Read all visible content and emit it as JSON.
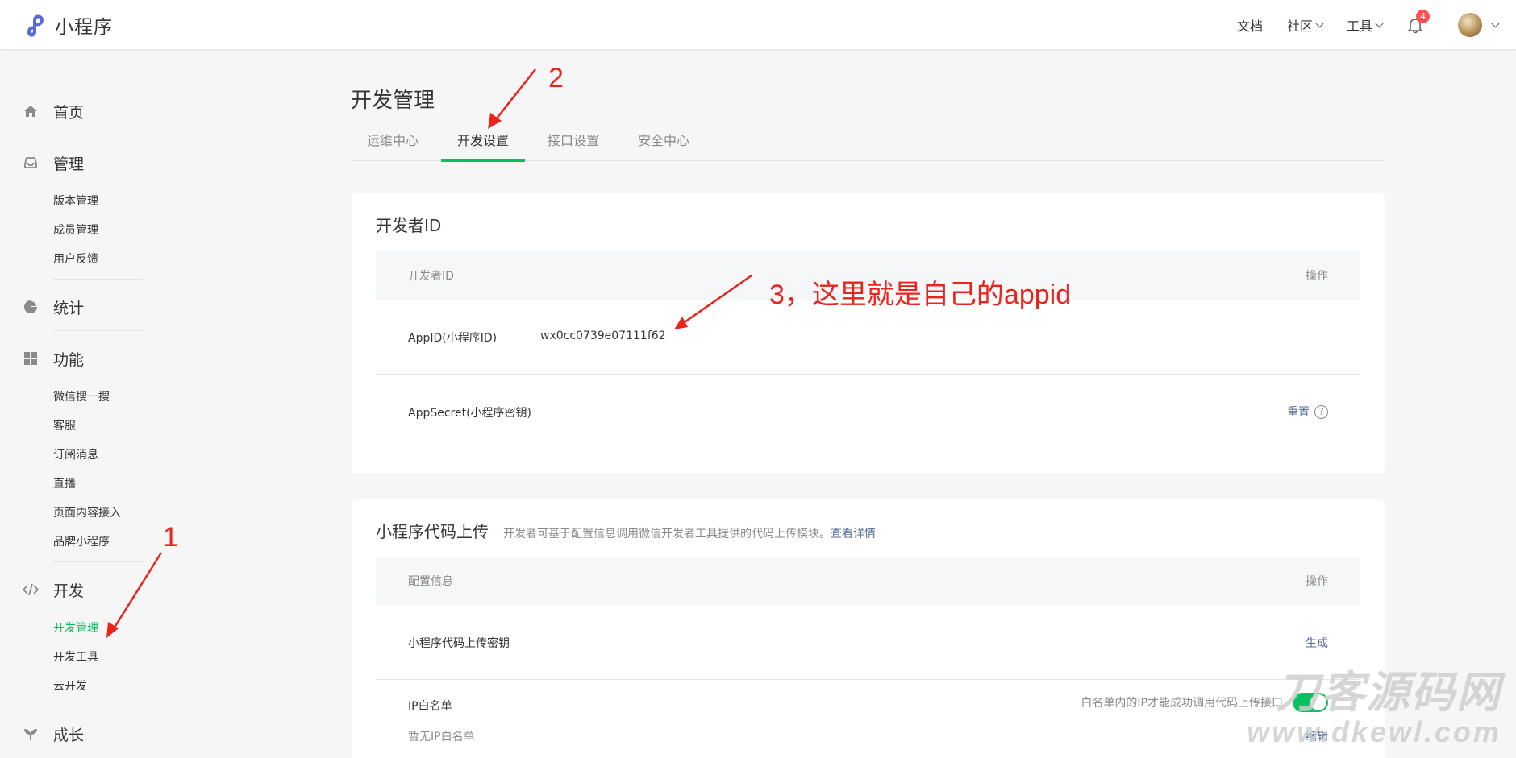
{
  "header": {
    "logo_text": "小程序",
    "nav": [
      {
        "label": "文档",
        "has_dropdown": false
      },
      {
        "label": "社区",
        "has_dropdown": true
      },
      {
        "label": "工具",
        "has_dropdown": true
      }
    ],
    "notification_count": "4"
  },
  "sidebar": {
    "groups": [
      {
        "label": "首页",
        "icon": "home-icon",
        "items": []
      },
      {
        "label": "管理",
        "icon": "inbox-icon",
        "items": [
          "版本管理",
          "成员管理",
          "用户反馈"
        ]
      },
      {
        "label": "统计",
        "icon": "pie-chart-icon",
        "items": []
      },
      {
        "label": "功能",
        "icon": "grid-icon",
        "items": [
          "微信搜一搜",
          "客服",
          "订阅消息",
          "直播",
          "页面内容接入",
          "品牌小程序"
        ]
      },
      {
        "label": "开发",
        "icon": "code-icon",
        "items": [
          "开发管理",
          "开发工具",
          "云开发"
        ]
      },
      {
        "label": "成长",
        "icon": "sprout-icon",
        "items": []
      }
    ],
    "active_item": "开发管理"
  },
  "main": {
    "title": "开发管理",
    "tabs": [
      "运维中心",
      "开发设置",
      "接口设置",
      "安全中心"
    ],
    "active_tab": "开发设置",
    "developer_card": {
      "title": "开发者ID",
      "header_left": "开发者ID",
      "header_right": "操作",
      "appid_label": "AppID(小程序ID)",
      "appid_value": "wx0cc0739e07111f62",
      "secret_label": "AppSecret(小程序密钥)",
      "secret_action": "重置",
      "help": "?"
    },
    "upload_card": {
      "title": "小程序代码上传",
      "desc": "开发者可基于配置信息调用微信开发者工具提供的代码上传模块。",
      "desc_link": "查看详情",
      "header_left": "配置信息",
      "header_right": "操作",
      "key_label": "小程序代码上传密钥",
      "key_action": "生成",
      "ip_label": "IP白名单",
      "ip_empty": "暂无IP白名单",
      "ip_hint": "白名单内的IP才能成功调用代码上传接口",
      "ip_toggle_on": true,
      "ip_action": "编辑"
    }
  },
  "annotations": {
    "a1": "1",
    "a2": "2",
    "a3": "3，这里就是自己的appid",
    "color": "#e8241b"
  },
  "watermark": {
    "line1": "刀客源码网",
    "line2": "www.dkewl.com"
  },
  "colors": {
    "accent": "#07c160",
    "link": "#576b95",
    "badge": "#fa5151"
  }
}
